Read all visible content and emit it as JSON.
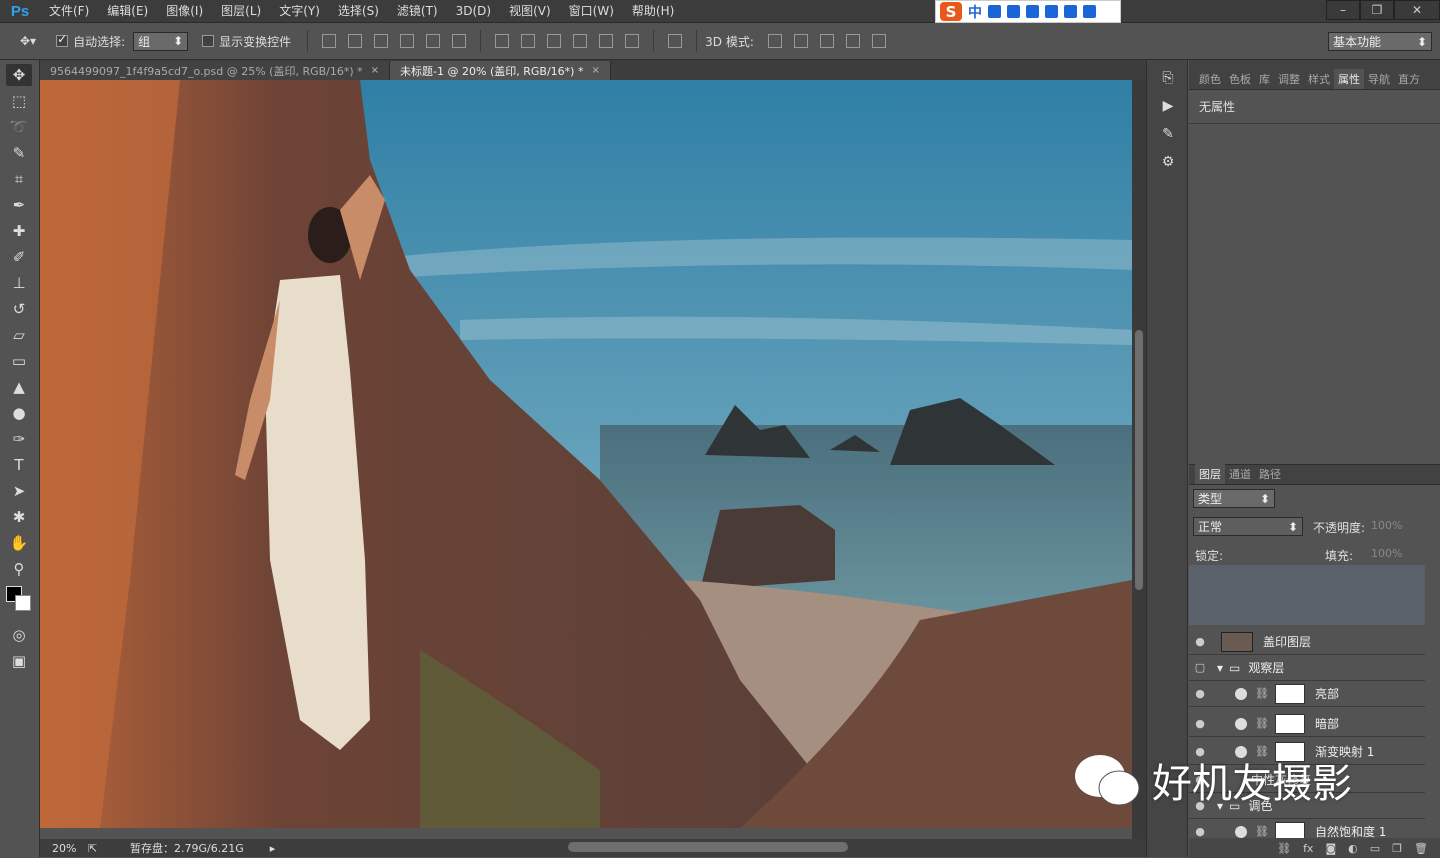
{
  "app": {
    "logo": "Ps"
  },
  "menu": [
    "文件(F)",
    "编辑(E)",
    "图像(I)",
    "图层(L)",
    "文字(Y)",
    "选择(S)",
    "滤镜(T)",
    "3D(D)",
    "视图(V)",
    "窗口(W)",
    "帮助(H)"
  ],
  "ime": {
    "logo": "S",
    "lang": "中"
  },
  "options": {
    "auto_select_label": "自动选择:",
    "auto_select_value": "组",
    "show_transform_label": "显示变换控件",
    "mode3d_label": "3D 模式:",
    "workspace": "基本功能"
  },
  "tabs": [
    {
      "title": "9564499097_1f4f9a5cd7_o.psd @ 25% (盖印, RGB/16*) *",
      "close": "×"
    },
    {
      "title": "未标题-1 @ 20% (盖印, RGB/16*) *",
      "close": "×"
    }
  ],
  "status": {
    "zoom": "20%",
    "scratch": "暂存盘：2.79G/6.21G"
  },
  "props": {
    "tabs": [
      "颜色",
      "色板",
      "库",
      "调整",
      "样式",
      "属性",
      "导航",
      "直方"
    ],
    "active_tab": "属性",
    "empty_text": "无属性"
  },
  "layers": {
    "tabs": [
      "图层",
      "通道",
      "路径"
    ],
    "filter_label": "类型",
    "blend_mode": "正常",
    "opacity_label": "不透明度:",
    "opacity_value": "100%",
    "lock_label": "锁定:",
    "fill_label": "填充:",
    "fill_value": "100%",
    "items": [
      {
        "name": "盖印图层"
      },
      {
        "name": "观察层"
      },
      {
        "name": "亮部"
      },
      {
        "name": "暗部"
      },
      {
        "name": "渐变映射 1"
      },
      {
        "name": "中性灰修复"
      },
      {
        "name": "调色"
      },
      {
        "name": "自然饱和度 1"
      }
    ]
  },
  "watermark": "好机友摄影",
  "colors": {
    "sky": "#3e8db0",
    "sea": "#4c7a8a",
    "rock": "#8a4e32",
    "ps_blue": "#2ea3ea"
  }
}
